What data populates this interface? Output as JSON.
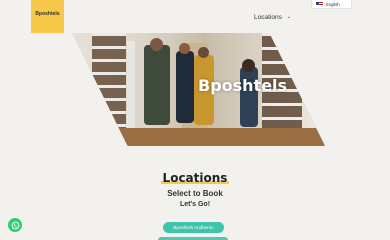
{
  "logo": {
    "text": "Bposhtels"
  },
  "nav": {
    "locations_label": "Locations"
  },
  "language": {
    "current": "English"
  },
  "hero": {
    "title": "Bposhtels"
  },
  "section": {
    "title": "Locations",
    "subtitle": "Select to Book",
    "tagline": "Let's Go!"
  },
  "cta": {
    "label": "Bposhtels Andheron"
  },
  "colors": {
    "brand_yellow": "#f7c94b",
    "accent_teal": "#3ec4a8",
    "whatsapp_green": "#25d366"
  },
  "icons": {
    "nav_chevron": "chevron-down-icon",
    "flag": "us-flag-icon",
    "chat": "whatsapp-icon"
  }
}
